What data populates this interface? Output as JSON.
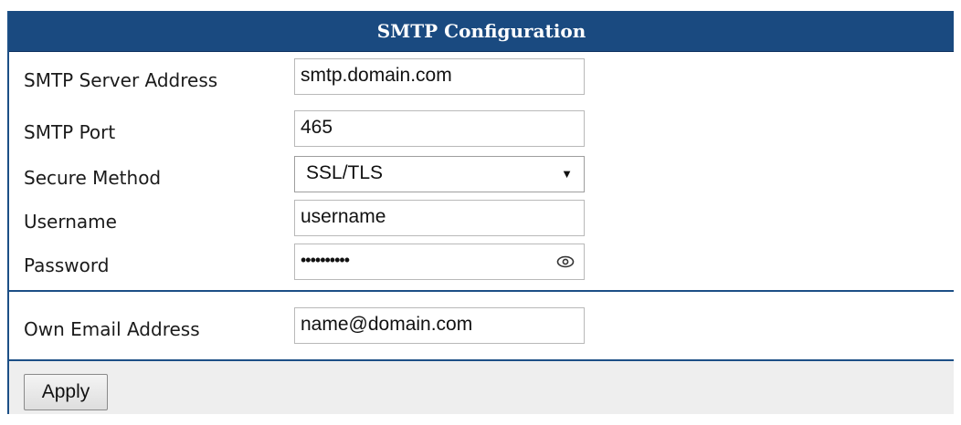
{
  "panel": {
    "title": "SMTP Configuration"
  },
  "fields": {
    "server": {
      "label": "SMTP Server Address",
      "value": "smtp.domain.com"
    },
    "port": {
      "label": "SMTP Port",
      "value": "465"
    },
    "secure": {
      "label": "Secure Method",
      "value": "SSL/TLS",
      "arrow_icon": "dropdown-arrow-icon"
    },
    "username": {
      "label": "Username",
      "value": "username"
    },
    "password": {
      "label": "Password",
      "masked_value": "••••••••••",
      "toggle_icon": "eye-icon"
    },
    "own_email": {
      "label": "Own Email Address",
      "value": "name@domain.com"
    }
  },
  "actions": {
    "apply_label": "Apply"
  },
  "colors": {
    "header_bg": "#1a4a80",
    "header_text": "#ffffff",
    "divider": "#1c4f86",
    "footer_bg": "#eeeeee"
  }
}
